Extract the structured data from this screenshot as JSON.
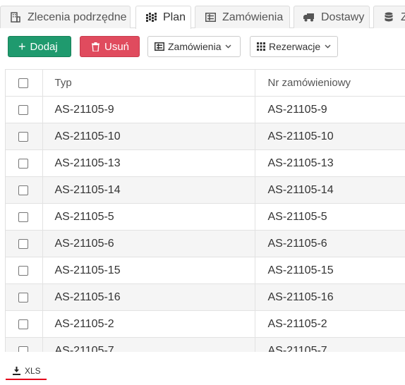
{
  "tabs": [
    {
      "label": "Zlecenia podrzędne",
      "icon": "building-icon",
      "active": false
    },
    {
      "label": "Plan",
      "icon": "grid-icon",
      "active": true
    },
    {
      "label": "Zamówienia",
      "icon": "list-icon",
      "active": false
    },
    {
      "label": "Dostawy",
      "icon": "truck-icon",
      "active": false
    },
    {
      "label": "Z",
      "icon": "database-icon",
      "active": false
    }
  ],
  "toolbar": {
    "add_label": "Dodaj",
    "delete_label": "Usuń",
    "orders_label": "Zamówienia",
    "reservations_label": "Rezerwacje",
    "add_color": "#1f9a6e",
    "delete_color": "#e04b5e"
  },
  "table": {
    "columns": [
      "Typ",
      "Nr zamówieniowy"
    ],
    "rows": [
      {
        "typ": "AS-21105-9",
        "nr": "AS-21105-9"
      },
      {
        "typ": "AS-21105-10",
        "nr": "AS-21105-10"
      },
      {
        "typ": "AS-21105-13",
        "nr": "AS-21105-13"
      },
      {
        "typ": "AS-21105-14",
        "nr": "AS-21105-14"
      },
      {
        "typ": "AS-21105-5",
        "nr": "AS-21105-5"
      },
      {
        "typ": "AS-21105-6",
        "nr": "AS-21105-6"
      },
      {
        "typ": "AS-21105-15",
        "nr": "AS-21105-15"
      },
      {
        "typ": "AS-21105-16",
        "nr": "AS-21105-16"
      },
      {
        "typ": "AS-21105-2",
        "nr": "AS-21105-2"
      },
      {
        "typ": "AS-21105-7",
        "nr": "AS-21105-7"
      }
    ]
  },
  "footer": {
    "export_label": "XLS",
    "underline_color": "#e3001b"
  }
}
